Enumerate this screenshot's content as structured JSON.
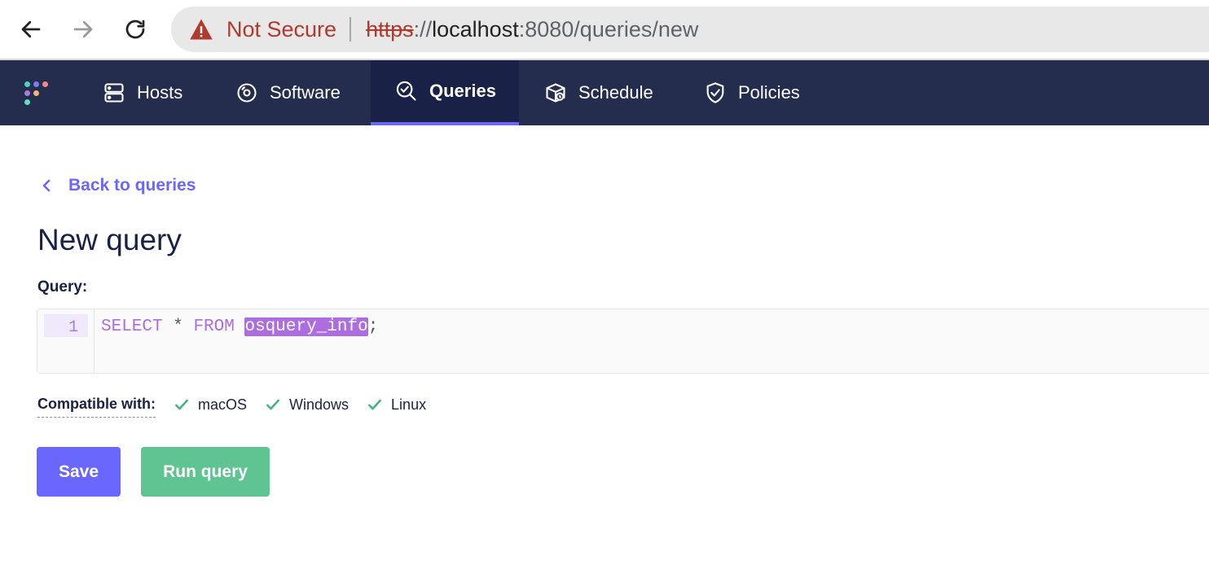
{
  "browser": {
    "warning_text": "Not Secure",
    "url_scheme": "https",
    "url_sep": "://",
    "url_host": "localhost",
    "url_port": ":8080",
    "url_path": "/queries/new"
  },
  "nav": {
    "items": [
      {
        "label": "Hosts",
        "icon": "server-icon"
      },
      {
        "label": "Software",
        "icon": "disc-icon"
      },
      {
        "label": "Queries",
        "icon": "query-magnifier-icon",
        "active": true
      },
      {
        "label": "Schedule",
        "icon": "schedule-box-icon"
      },
      {
        "label": "Policies",
        "icon": "shield-check-icon"
      }
    ],
    "accent": "#6a67fe",
    "bg": "#252d4f"
  },
  "page": {
    "back_label": "Back to queries",
    "title": "New query",
    "query_label": "Query:"
  },
  "editor": {
    "line_number": "1",
    "tokens": {
      "select": "SELECT",
      "star": " * ",
      "from": "FROM",
      "space": " ",
      "table": "osquery_info",
      "semicolon": ";"
    }
  },
  "compat": {
    "label": "Compatible with:",
    "platforms": [
      "macOS",
      "Windows",
      "Linux"
    ],
    "check_color": "#3db67b"
  },
  "actions": {
    "save_label": "Save",
    "run_label": "Run query"
  }
}
